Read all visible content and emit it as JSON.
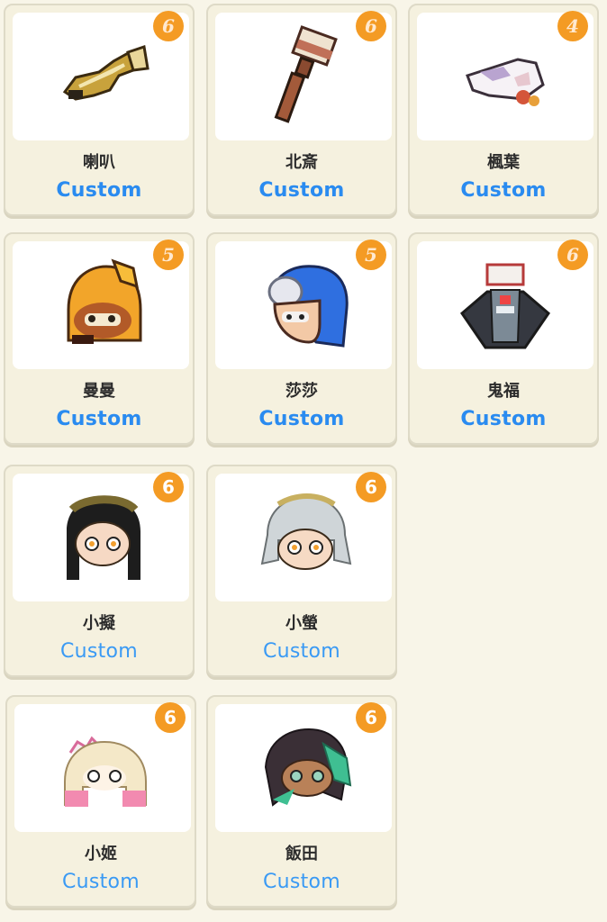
{
  "cards": [
    {
      "name": "喇叭",
      "status": "Custom",
      "badge": "6",
      "icon": "trumpet-weapon-icon"
    },
    {
      "name": "北斎",
      "status": "Custom",
      "badge": "6",
      "icon": "paintbrush-weapon-icon"
    },
    {
      "name": "楓葉",
      "status": "Custom",
      "badge": "4",
      "icon": "folded-fan-weapon-icon"
    },
    {
      "name": "曼曼",
      "status": "Custom",
      "badge": "5",
      "icon": "orange-inkling-avatar-icon"
    },
    {
      "name": "莎莎",
      "status": "Custom",
      "badge": "5",
      "icon": "blue-inkling-avatar-icon"
    },
    {
      "name": "鬼福",
      "status": "Custom",
      "badge": "6",
      "icon": "hooded-figure-avatar-icon"
    },
    {
      "name": "小擬",
      "status": "Custom",
      "badge": "6",
      "icon": "callie-avatar-icon"
    },
    {
      "name": "小螢",
      "status": "Custom",
      "badge": "6",
      "icon": "marie-avatar-icon"
    },
    {
      "name": "小姬",
      "status": "Custom",
      "badge": "6",
      "icon": "pearl-avatar-icon"
    },
    {
      "name": "飯田",
      "status": "Custom",
      "badge": "6",
      "icon": "marina-avatar-icon"
    }
  ],
  "colors": {
    "badge": "#f49b24",
    "status": "#2a8bf0",
    "background": "#f8f5e8"
  }
}
